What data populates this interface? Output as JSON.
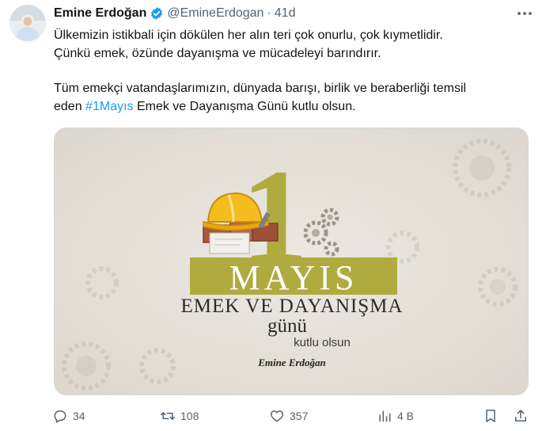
{
  "tweet": {
    "author_name": "Emine Erdoğan",
    "handle": "@EmineErdogan",
    "separator": "·",
    "time": "41d",
    "text_line1": "Ülkemizin istikbali için dökülen her alın teri çok onurlu, çok kıymetlidir.",
    "text_line2": "Çünkü emek, özünde dayanışma ve mücadeleyi barındırır.",
    "text_line3": "Tüm emekçi vatandaşlarımızın, dünyada barışı, birlik ve beraberliği temsil",
    "text_line4_prefix": "eden ",
    "hashtag": "#1Mayıs",
    "text_line4_suffix": " Emek ve Dayanışma Günü kutlu olsun."
  },
  "media": {
    "big_number": "1",
    "month": "MAYIS",
    "subtitle": "EMEK VE DAYANIŞMA",
    "day_word": "günü",
    "wish": "kutlu olsun",
    "signature": "Emine Erdoğan"
  },
  "actions": {
    "replies": "34",
    "retweets": "108",
    "likes": "357",
    "views": "4 B"
  },
  "colors": {
    "olive": "#b0ab3e",
    "link": "#1d9bf0",
    "muted": "#536471",
    "verified": "#1d9bf0"
  }
}
